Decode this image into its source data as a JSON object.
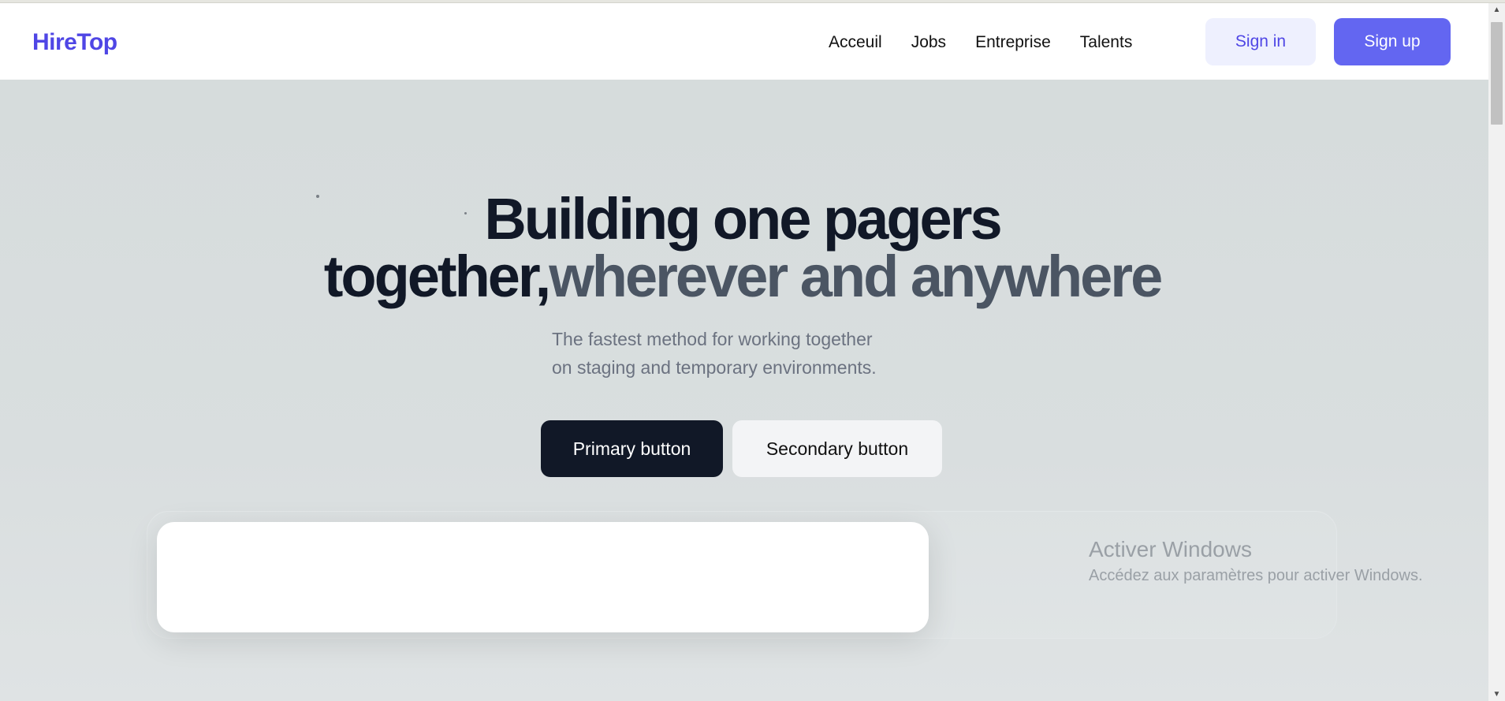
{
  "brand": {
    "name": "HireTop",
    "accent": "#4f46e5",
    "signup_bg": "#6366f1",
    "signin_bg": "#eef0fe"
  },
  "nav": {
    "links": [
      "Acceuil",
      "Jobs",
      "Entreprise",
      "Talents"
    ],
    "sign_in": "Sign in",
    "sign_up": "Sign up"
  },
  "hero": {
    "title_line1": "Building one pagers",
    "title_line2_dark": "together,",
    "title_line2_muted": "wherever and anywhere",
    "subtitle_line1": "The fastest method for working together",
    "subtitle_line2": "on staging and temporary environments.",
    "primary_button": "Primary button",
    "secondary_button": "Secondary button"
  },
  "os_watermark": {
    "title": "Activer Windows",
    "subtitle": "Accédez aux paramètres pour activer Windows."
  },
  "scrollbar": {
    "up_icon": "scroll-up-arrow-icon",
    "down_icon": "scroll-down-arrow-icon"
  }
}
